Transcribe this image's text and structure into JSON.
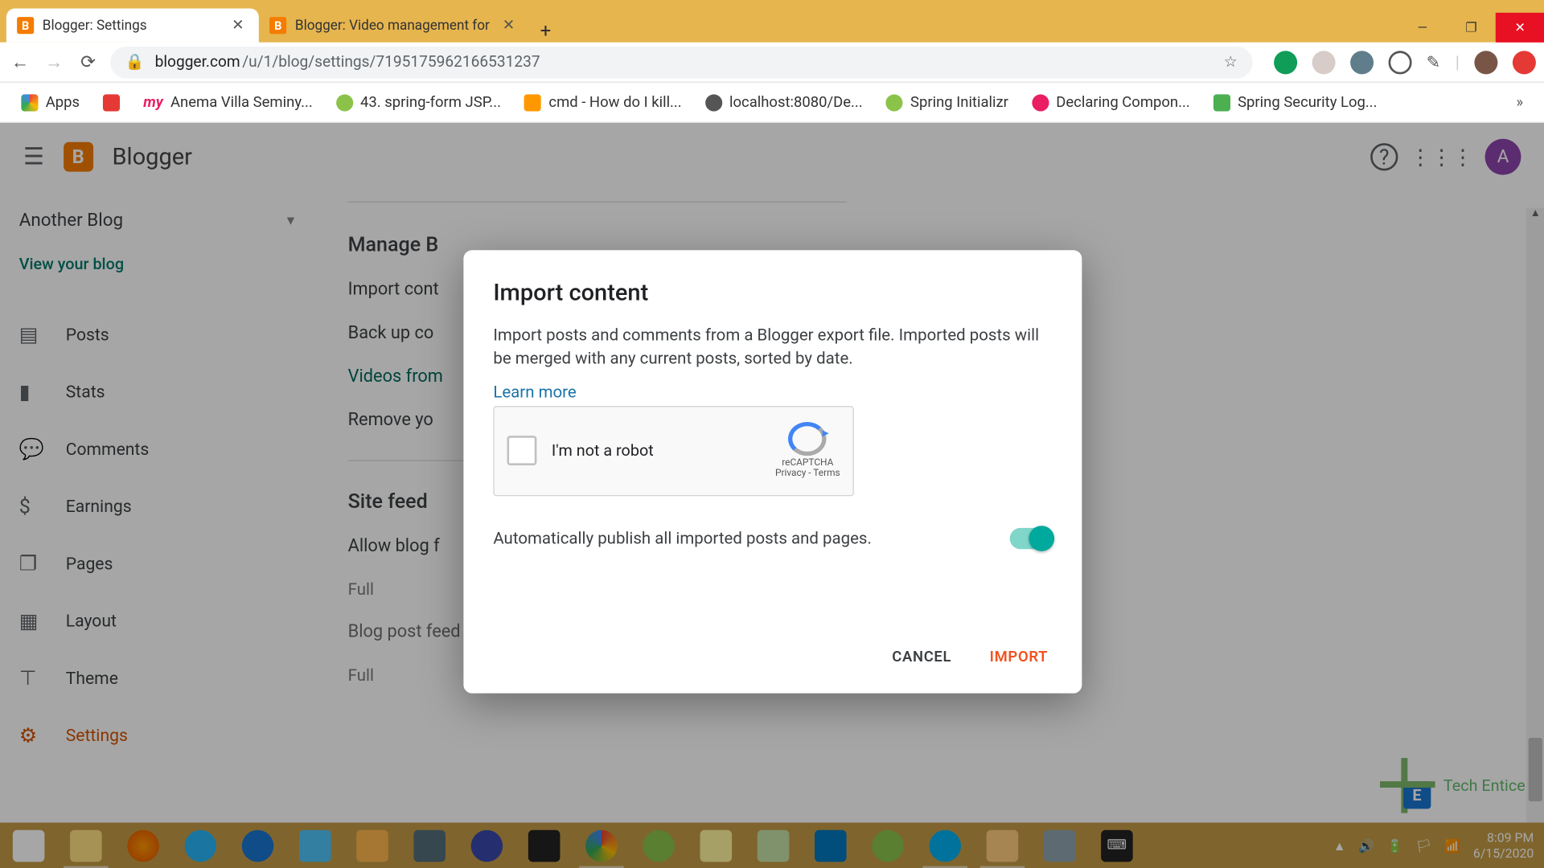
{
  "tabs": [
    {
      "title": "Blogger: Settings",
      "active": true
    },
    {
      "title": "Blogger: Video management for",
      "active": false
    }
  ],
  "url_host": "blogger.com",
  "url_path": "/u/1/blog/settings/7195175962166531237",
  "bookmarks": [
    {
      "label": "Apps"
    },
    {
      "label": ""
    },
    {
      "label": "Anema Villa Seminy...",
      "prefix": "my"
    },
    {
      "label": "43. spring-form JSP..."
    },
    {
      "label": "cmd - How do I kill..."
    },
    {
      "label": "localhost:8080/De..."
    },
    {
      "label": "Spring Initializr"
    },
    {
      "label": "Declaring Compon..."
    },
    {
      "label": "Spring Security Log..."
    }
  ],
  "header": {
    "brand": "Blogger",
    "avatar_initial": "A"
  },
  "sidebar": {
    "blog_selector": "Another Blog",
    "view_blog": "View your blog",
    "items": [
      {
        "label": "Posts"
      },
      {
        "label": "Stats"
      },
      {
        "label": "Comments"
      },
      {
        "label": "Earnings"
      },
      {
        "label": "Pages"
      },
      {
        "label": "Layout"
      },
      {
        "label": "Theme"
      },
      {
        "label": "Settings",
        "active": true
      }
    ]
  },
  "content": {
    "section1_title": "Manage B",
    "row_import": "Import cont",
    "row_backup": "Back up co",
    "row_videos": "Videos from",
    "row_remove": "Remove yo",
    "section2_title": "Site feed",
    "row_allow": "Allow blog f",
    "row_allow_val": "Full",
    "row_blogpost": "Blog post feed",
    "row_blogpost_val": "Full"
  },
  "modal": {
    "title": "Import content",
    "description": "Import posts and comments from a Blogger export file. Imported posts will be merged with any current posts, sorted by date.",
    "learn_more": "Learn more",
    "recaptcha_label": "I'm not a robot",
    "recaptcha_brand": "reCAPTCHA",
    "recaptcha_legal": "Privacy - Terms",
    "toggle_label": "Automatically publish all imported posts and pages.",
    "cancel": "CANCEL",
    "import": "IMPORT"
  },
  "tray": {
    "time": "8:09 PM",
    "date": "6/15/2020"
  },
  "watermark": "Tech Entice"
}
